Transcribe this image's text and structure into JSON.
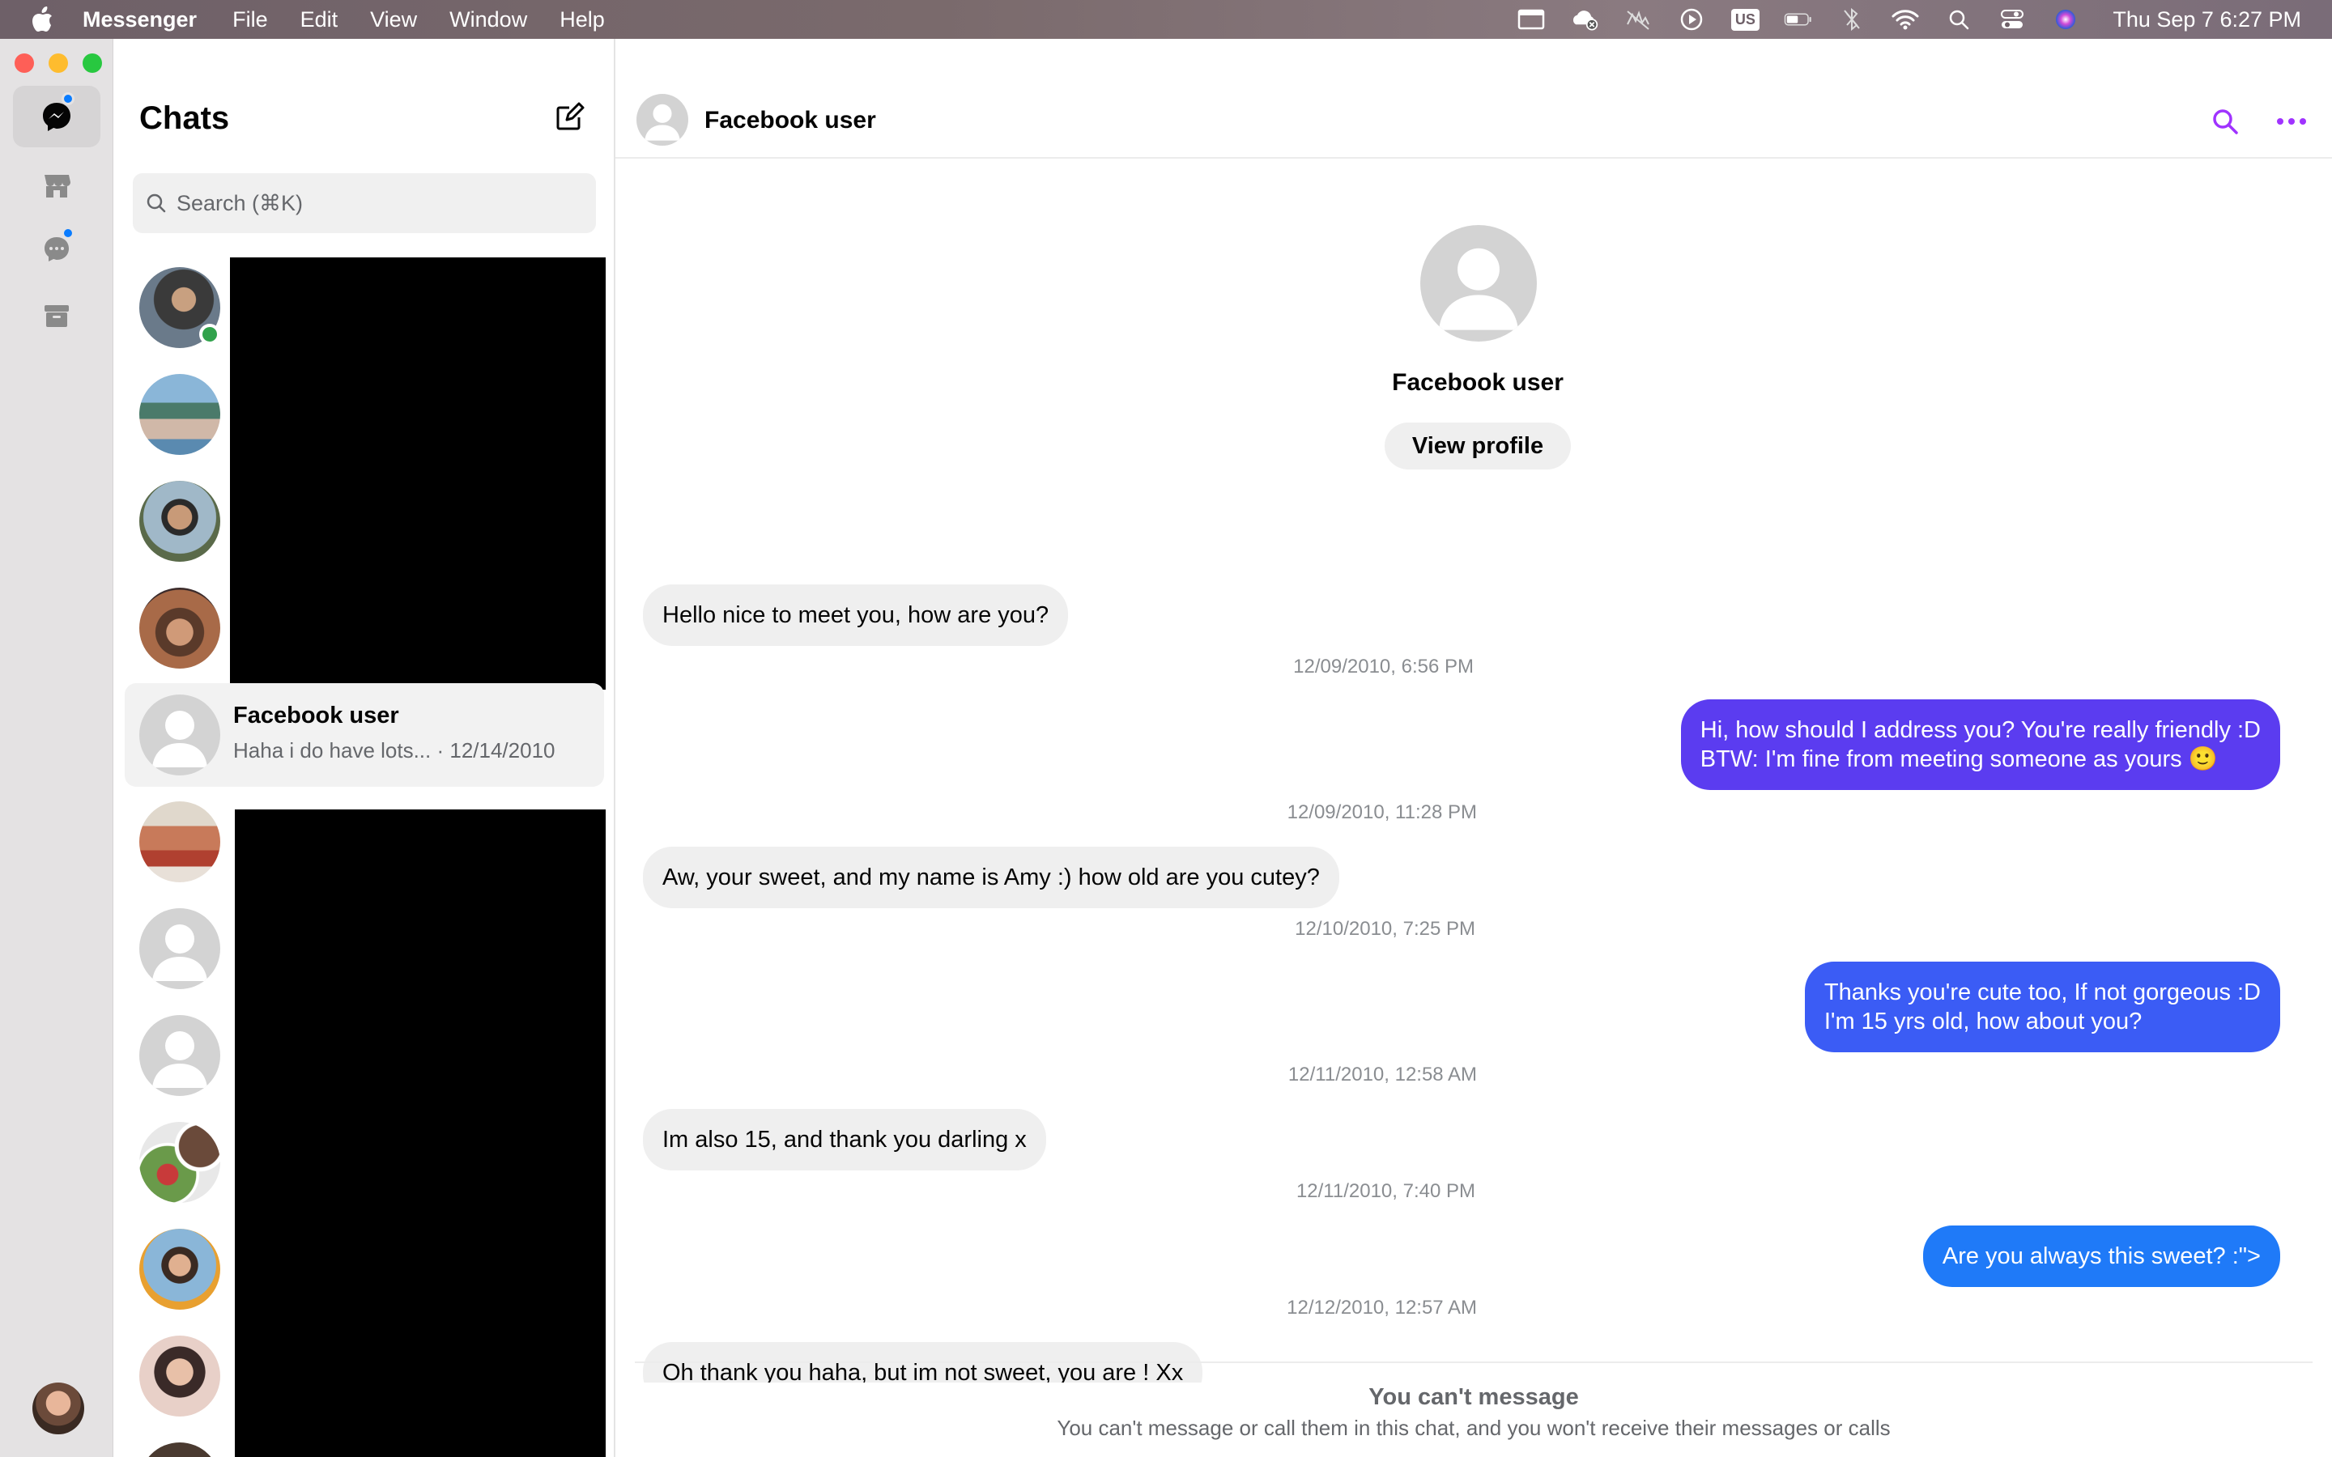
{
  "menubar": {
    "app_name": "Messenger",
    "menus": [
      "File",
      "Edit",
      "View",
      "Window",
      "Help"
    ],
    "keyboard_badge": "US",
    "clock": "Thu Sep 7  6:27 PM"
  },
  "chats": {
    "title": "Chats",
    "search_placeholder": "Search (⌘K)",
    "selected": {
      "name": "Facebook user",
      "preview": "Haha i do have lots... · 12/14/2010"
    }
  },
  "conversation": {
    "header_name": "Facebook user",
    "profile_name": "Facebook user",
    "view_profile_label": "View profile",
    "messages": [
      {
        "dir": "in",
        "lines": [
          "Hello nice to meet you, how are you?"
        ]
      },
      {
        "ts": "12/09/2010, 6:56 PM"
      },
      {
        "dir": "out",
        "lines": [
          "Hi, how should I address you? You're really friendly :D",
          "BTW: I'm fine from meeting someone as yours 🙂"
        ]
      },
      {
        "ts": "12/09/2010, 11:28 PM"
      },
      {
        "dir": "in",
        "lines": [
          "Aw, your sweet, and my name is Amy :) how old are you cutey?"
        ]
      },
      {
        "ts": "12/10/2010, 7:25 PM"
      },
      {
        "dir": "out",
        "lines": [
          "Thanks you're cute too, If not gorgeous :D",
          "I'm 15 yrs old, how about you?"
        ]
      },
      {
        "ts": "12/11/2010, 12:58 AM"
      },
      {
        "dir": "in",
        "lines": [
          "Im also 15, and thank you darling x"
        ]
      },
      {
        "ts": "12/11/2010, 7:40 PM"
      },
      {
        "dir": "out",
        "lines": [
          "Are you always this sweet? :\">"
        ]
      },
      {
        "ts": "12/12/2010, 12:57 AM"
      },
      {
        "dir": "in",
        "lines": [
          "Oh thank you haha, but im not sweet, you are ! Xx"
        ]
      }
    ],
    "footer_title": "You can't message",
    "footer_subtitle": "You can't message or call them in this chat, and you won't receive their messages or calls"
  },
  "colors": {
    "accent_purple": "#a033ff",
    "bubble_out_1": "#5b3cf0",
    "bubble_out_2": "#3b5cf5",
    "bubble_out_3": "#1f7af8",
    "online": "#31a24c"
  }
}
